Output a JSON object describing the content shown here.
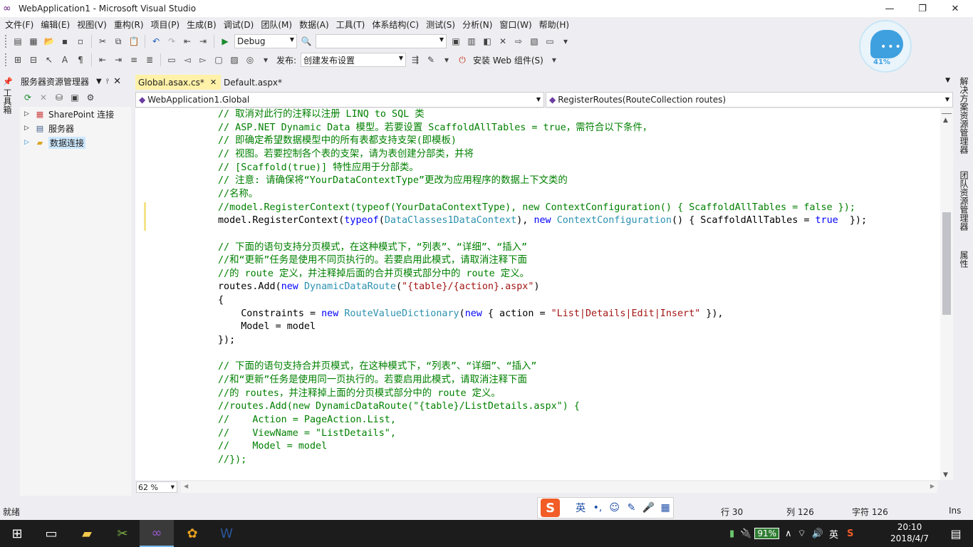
{
  "window": {
    "title": "WebApplication1 - Microsoft Visual Studio",
    "minimize": "—",
    "restore": "❐",
    "close": "✕"
  },
  "menu": [
    "文件(F)",
    "编辑(E)",
    "视图(V)",
    "重构(R)",
    "项目(P)",
    "生成(B)",
    "调试(D)",
    "团队(M)",
    "数据(A)",
    "工具(T)",
    "体系结构(C)",
    "测试(S)",
    "分析(N)",
    "窗口(W)",
    "帮助(H)"
  ],
  "toolbar": {
    "config": "Debug",
    "search_value": "",
    "publish_label": "发布:",
    "publish_profile": "创建发布设置",
    "install_web_components": "安装 Web 组件(S)"
  },
  "chat_widget": {
    "percent": "41%"
  },
  "left_sidetab": "工具箱",
  "server_explorer": {
    "title": "服务器资源管理器",
    "nodes": [
      {
        "label": "SharePoint 连接",
        "expander": "▷"
      },
      {
        "label": "服务器",
        "expander": "▷"
      },
      {
        "label": "数据连接",
        "expander": "▷",
        "selected": true
      }
    ]
  },
  "editor_tabs": [
    {
      "label": "Global.asax.cs*",
      "active": true
    },
    {
      "label": "Default.aspx*",
      "active": false
    }
  ],
  "navbar": {
    "type_combo": "WebApplication1.Global",
    "member_combo": "RegisterRoutes(RouteCollection routes)"
  },
  "code_lines": [
    [
      [
        "cm",
        "// 取消对此行的注释以注册 LINQ to SQL 类"
      ]
    ],
    [
      [
        "cm",
        "// ASP.NET Dynamic Data 模型。若要设置 ScaffoldAllTables = true，需符合以下条件，"
      ]
    ],
    [
      [
        "cm",
        "// 即确定希望数据模型中的所有表都支持支架(即模板)"
      ]
    ],
    [
      [
        "cm",
        "// 视图。若要控制各个表的支架，请为表创建分部类，并将"
      ]
    ],
    [
      [
        "cm",
        "// [Scaffold(true)] 特性应用于分部类。"
      ]
    ],
    [
      [
        "cm",
        "// 注意: 请确保将“YourDataContextType”更改为应用程序的数据上下文类的"
      ]
    ],
    [
      [
        "cm",
        "//名称。"
      ]
    ],
    [
      [
        "cm",
        "//model.RegisterContext(typeof(YourDataContextType), new ContextConfiguration() { ScaffoldAllTables = false });"
      ]
    ],
    [
      [
        "",
        "model.RegisterContext("
      ],
      [
        "kw",
        "typeof"
      ],
      [
        "",
        "("
      ],
      [
        "ty",
        "DataClasses1DataContext"
      ],
      [
        "",
        "), "
      ],
      [
        "kw",
        "new"
      ],
      [
        "",
        " "
      ],
      [
        "ty",
        "ContextConfiguration"
      ],
      [
        "",
        "() { ScaffoldAllTables = "
      ],
      [
        "kw",
        "true"
      ],
      [
        "",
        "  });"
      ]
    ],
    [],
    [
      [
        "cm",
        "// 下面的语句支持分页模式，在这种模式下，“列表”、“详细”、“插入”"
      ]
    ],
    [
      [
        "cm",
        "//和“更新”任务是使用不同页执行的。若要启用此模式，请取消注释下面"
      ]
    ],
    [
      [
        "cm",
        "//的 route 定义，并注释掉后面的合并页模式部分中的 route 定义。"
      ]
    ],
    [
      [
        "",
        "routes.Add("
      ],
      [
        "kw",
        "new"
      ],
      [
        "",
        " "
      ],
      [
        "ty",
        "DynamicDataRoute"
      ],
      [
        "",
        "("
      ],
      [
        "st",
        "\"{table}/{action}.aspx\""
      ],
      [
        "",
        ")"
      ]
    ],
    [
      [
        "",
        "{"
      ]
    ],
    [
      [
        "",
        "    Constraints = "
      ],
      [
        "kw",
        "new"
      ],
      [
        "",
        " "
      ],
      [
        "ty",
        "RouteValueDictionary"
      ],
      [
        "",
        "("
      ],
      [
        "kw",
        "new"
      ],
      [
        "",
        " { action = "
      ],
      [
        "st",
        "\"List|Details|Edit|Insert\""
      ],
      [
        "",
        " }),"
      ]
    ],
    [
      [
        "",
        "    Model = model"
      ]
    ],
    [
      [
        "",
        "});"
      ]
    ],
    [],
    [
      [
        "cm",
        "// 下面的语句支持合并页模式，在这种模式下，“列表”、“详细”、“插入”"
      ]
    ],
    [
      [
        "cm",
        "//和“更新”任务是使用同一页执行的。若要启用此模式，请取消注释下面"
      ]
    ],
    [
      [
        "cm",
        "//的 routes，并注释掉上面的分页模式部分中的 route 定义。"
      ]
    ],
    [
      [
        "cm",
        "//routes.Add(new DynamicDataRoute(\"{table}/ListDetails.aspx\") {"
      ]
    ],
    [
      [
        "cm",
        "//    Action = PageAction.List,"
      ]
    ],
    [
      [
        "cm",
        "//    ViewName = \"ListDetails\","
      ]
    ],
    [
      [
        "cm",
        "//    Model = model"
      ]
    ],
    [
      [
        "cm",
        "//});"
      ]
    ]
  ],
  "zoom": "62 %",
  "right_sidetabs": [
    "解决方案资源管理器",
    "团队资源管理器",
    "属性"
  ],
  "status": {
    "ready": "就绪",
    "line": "行 30",
    "col": "列 126",
    "char": "字符 126",
    "mode": "Ins"
  },
  "ime": {
    "logo": "S",
    "lang": "英"
  },
  "taskbar": {
    "battery_percent": "91%",
    "ime_lang": "英",
    "time": "20:10",
    "date": "2018/4/7"
  },
  "colors": {
    "active_tab": "#fff1a8",
    "comment": "#008000",
    "keyword": "#0000ff",
    "type": "#2b91af",
    "string": "#a31515"
  }
}
